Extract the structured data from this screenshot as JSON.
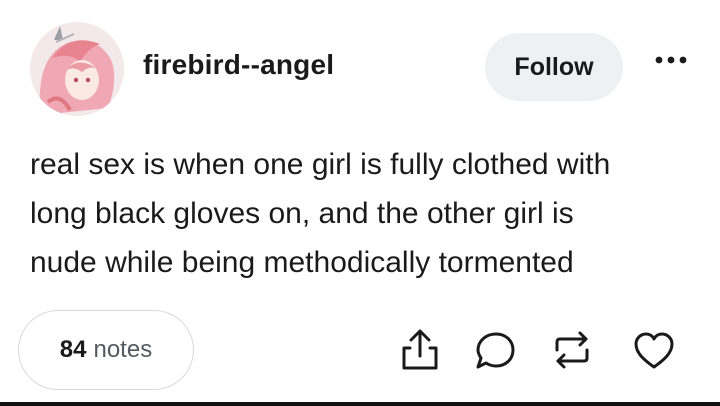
{
  "post": {
    "username": "firebird--angel",
    "follow_label": "Follow",
    "body_lines": [
      "real sex is when one girl is fully clothed with",
      "long black gloves on, and the other girl is",
      "nude while being methodically tormented"
    ],
    "notes_count": "84",
    "notes_label": "notes"
  },
  "icons": {
    "avatar": "anime-avatar",
    "more": "more-dots-icon",
    "share": "share-icon",
    "reply": "reply-bubble-icon",
    "reblog": "reblog-icon",
    "like": "heart-icon"
  },
  "colors": {
    "text": "#1a1a1a",
    "follow_bg": "#eef0f2",
    "icon": "#1a1a1a",
    "notes_border": "#d7d9dc"
  }
}
